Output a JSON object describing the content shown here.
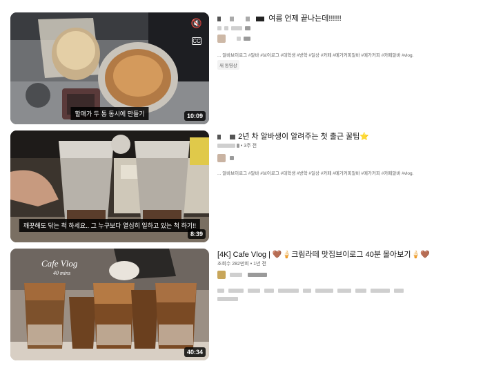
{
  "results": [
    {
      "title": "여름 언제 끝나는데!!!!!!",
      "caption": "할매가 두 통 동시에 만들기",
      "duration": "10:09",
      "tags": "... 알바브이로그 #알바 #브이로그 #대학생 #방학 #일상 #카페 #메가커피알바 #메가커피 #카페알바 #vlog.",
      "badge": "새 동영상",
      "icons": [
        "mute-icon",
        "cc-icon"
      ]
    },
    {
      "title": "2년 차 알바생이 알려주는 첫 출근 꿀팁⭐",
      "meta": "• 3주 전",
      "caption": "깨끗해도 닦는 척 하세요.. 그 누구보다 열심히 일하고 있는 척 하기!!",
      "duration": "8:39",
      "tags": "... 알바브이로그 #알바 #브이로그 #대학생 #방학 #일상 #카페 #메가커피알바 #메가커피 #카페알바 #vlog."
    },
    {
      "title": "[4K] Cafe Vlog | 🤎🍦크림라떼 맛집브이로그 40분 몰아보기🍦🤎",
      "meta": "조회수 282만회 • 1년 전",
      "overlay_title": "Cafe Vlog",
      "overlay_sub": "40 mins",
      "duration": "40:34"
    }
  ],
  "colors": {
    "duration_bg": "#000000",
    "text_secondary": "#606060",
    "badge_bg": "#f2f2f2"
  }
}
